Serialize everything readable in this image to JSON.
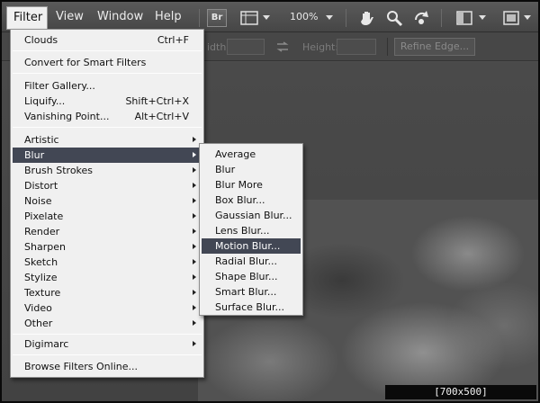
{
  "menubar": {
    "items": [
      "Filter",
      "View",
      "Window",
      "Help"
    ],
    "br_label": "Br",
    "zoom": "100%"
  },
  "options_bar": {
    "width_label": "idth:",
    "height_label": "Height:",
    "refine_edge": "Refine Edge..."
  },
  "filter_menu": {
    "group1": [
      {
        "label": "Clouds",
        "shortcut": "Ctrl+F"
      }
    ],
    "group2": [
      {
        "label": "Convert for Smart Filters"
      }
    ],
    "group3": [
      {
        "label": "Filter Gallery..."
      },
      {
        "label": "Liquify...",
        "shortcut": "Shift+Ctrl+X"
      },
      {
        "label": "Vanishing Point...",
        "shortcut": "Alt+Ctrl+V"
      }
    ],
    "submenus": [
      "Artistic",
      "Blur",
      "Brush Strokes",
      "Distort",
      "Noise",
      "Pixelate",
      "Render",
      "Sharpen",
      "Sketch",
      "Stylize",
      "Texture",
      "Video",
      "Other"
    ],
    "highlighted_submenu": "Blur",
    "group5": [
      {
        "label": "Digimarc"
      }
    ],
    "group6": [
      {
        "label": "Browse Filters Online..."
      }
    ]
  },
  "blur_menu": {
    "items": [
      "Average",
      "Blur",
      "Blur More",
      "Box Blur...",
      "Gaussian Blur...",
      "Lens Blur...",
      "Motion Blur...",
      "Radial Blur...",
      "Shape Blur...",
      "Smart Blur...",
      "Surface Blur..."
    ],
    "highlighted": "Motion Blur..."
  },
  "watermark": "[700x500] https://upic.me/",
  "colors": {
    "menu_bg": "#f0f0f0",
    "highlight": "#424754",
    "app_bg": "#4a4a4a"
  }
}
